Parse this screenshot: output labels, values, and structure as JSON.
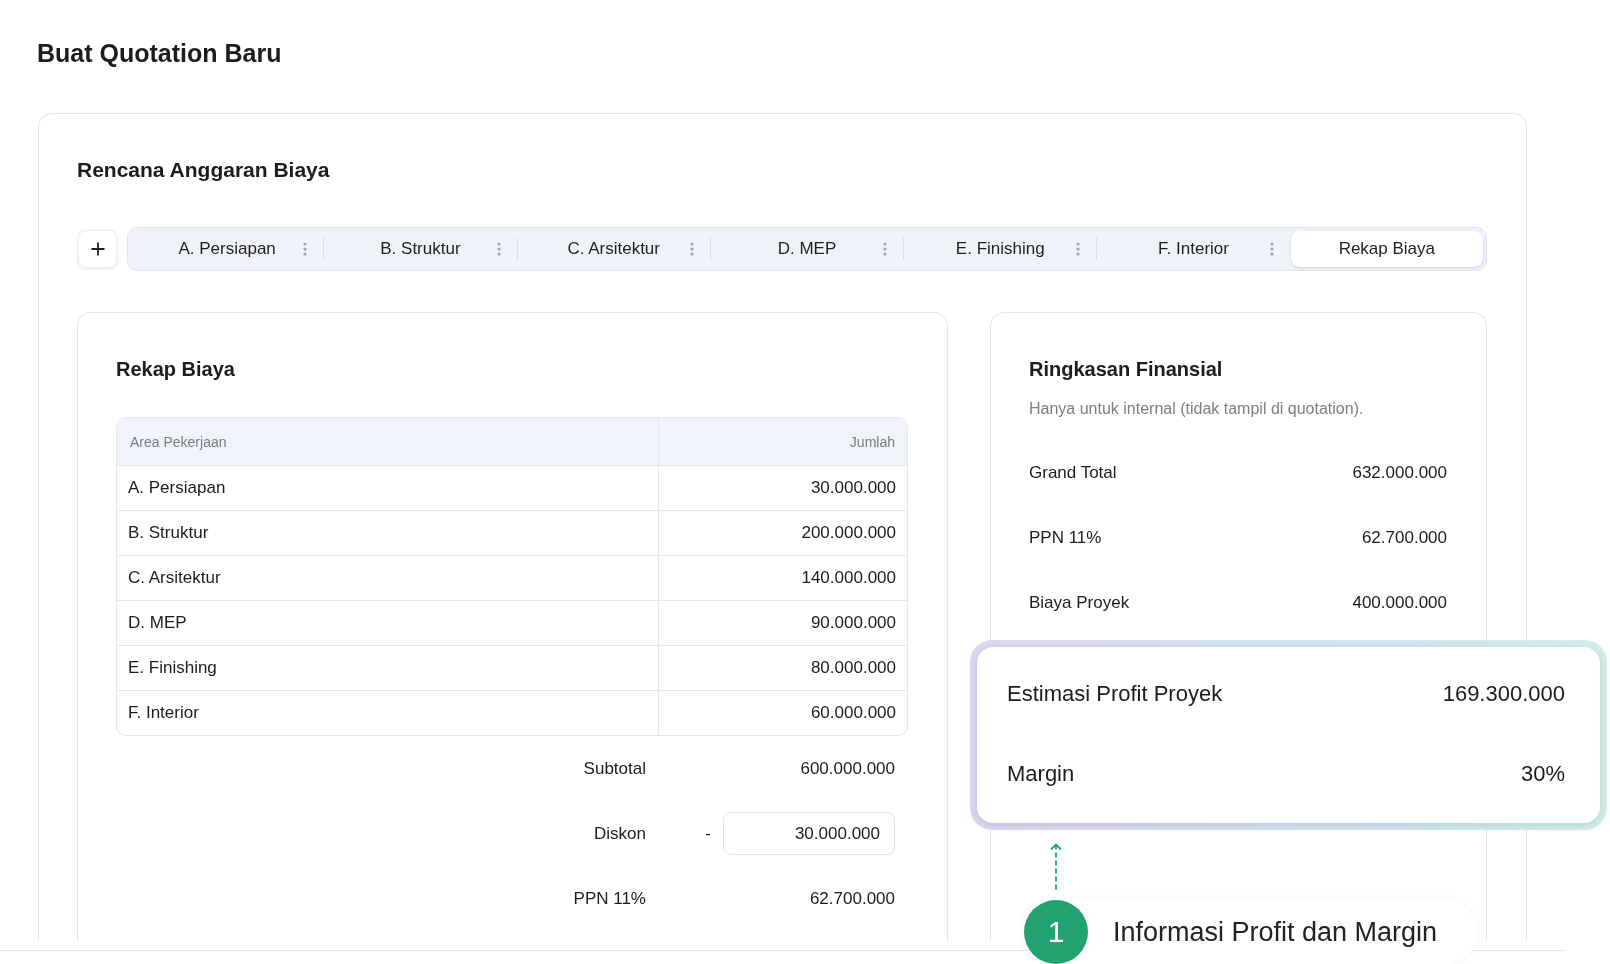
{
  "page": {
    "title": "Buat Quotation Baru"
  },
  "budget": {
    "title": "Rencana Anggaran Biaya",
    "tabs": [
      {
        "label": "A. Persiapan",
        "selected": false,
        "has_menu": true
      },
      {
        "label": "B. Struktur",
        "selected": false,
        "has_menu": true
      },
      {
        "label": "C. Arsitektur",
        "selected": false,
        "has_menu": true
      },
      {
        "label": "D. MEP",
        "selected": false,
        "has_menu": true
      },
      {
        "label": "E. Finishing",
        "selected": false,
        "has_menu": true
      },
      {
        "label": "F. Interior",
        "selected": false,
        "has_menu": true
      },
      {
        "label": "Rekap Biaya",
        "selected": true,
        "has_menu": false
      }
    ]
  },
  "recap": {
    "title": "Rekap Biaya",
    "table": {
      "columns": [
        "Area Pekerjaan",
        "Jumlah"
      ],
      "rows": [
        [
          "A. Persiapan",
          "30.000.000"
        ],
        [
          "B. Struktur",
          "200.000.000"
        ],
        [
          "C. Arsitektur",
          "140.000.000"
        ],
        [
          "D. MEP",
          "90.000.000"
        ],
        [
          "E. Finishing",
          "80.000.000"
        ],
        [
          "F. Interior",
          "60.000.000"
        ]
      ]
    },
    "totals": [
      {
        "kind": "text",
        "label": "Subtotal",
        "value": "600.000.000"
      },
      {
        "kind": "input",
        "label": "Diskon",
        "sign": "-",
        "value": "30.000.000"
      },
      {
        "kind": "text",
        "label": "PPN 11%",
        "value": "62.700.000"
      }
    ]
  },
  "financial_summary": {
    "title": "Ringkasan Finansial",
    "note": "Hanya untuk internal (tidak tampil di quotation).",
    "rows": [
      {
        "label": "Grand Total",
        "value": "632.000.000"
      },
      {
        "label": "PPN 11%",
        "value": "62.700.000"
      },
      {
        "label": "Biaya Proyek",
        "value": "400.000.000"
      }
    ]
  },
  "highlight": {
    "rows": [
      {
        "label": "Estimasi Profit Proyek",
        "value": "169.300.000"
      },
      {
        "label": "Margin",
        "value": "30%"
      }
    ]
  },
  "annotation": {
    "number": "1",
    "text": "Informasi Profit dan Margin"
  }
}
